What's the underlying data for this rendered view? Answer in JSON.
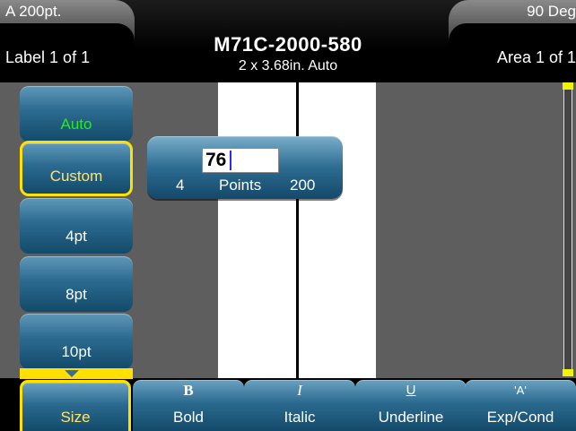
{
  "status_bar": {
    "font_size": "A 200pt.",
    "label_count": "Label 1 of 1",
    "rotation": "90 Deg",
    "area_count": "Area 1 of 1",
    "part_number": "M71C-2000-580",
    "label_dimensions": "2 x 3.68in. Auto"
  },
  "size_options": [
    {
      "label": "Auto",
      "color": "#26e826"
    },
    {
      "label": "Custom",
      "selected": true
    },
    {
      "label": "4pt"
    },
    {
      "label": "8pt"
    },
    {
      "label": "10pt"
    }
  ],
  "popup": {
    "value": "76",
    "min": "4",
    "unit": "Points",
    "max": "200"
  },
  "soft_keys": [
    {
      "glyph": "",
      "label": "Size",
      "selected": true
    },
    {
      "glyph": "B",
      "label": "Bold"
    },
    {
      "glyph": "I",
      "label": "Italic"
    },
    {
      "glyph": "U",
      "label": "Underline"
    },
    {
      "glyph": "'A'",
      "label": "Exp/Cond"
    }
  ],
  "colors": {
    "accent_selected": "#ffe000",
    "button_blue": "#2b6a8f",
    "auto_green": "#26e826",
    "background": "#5e5e5e"
  }
}
